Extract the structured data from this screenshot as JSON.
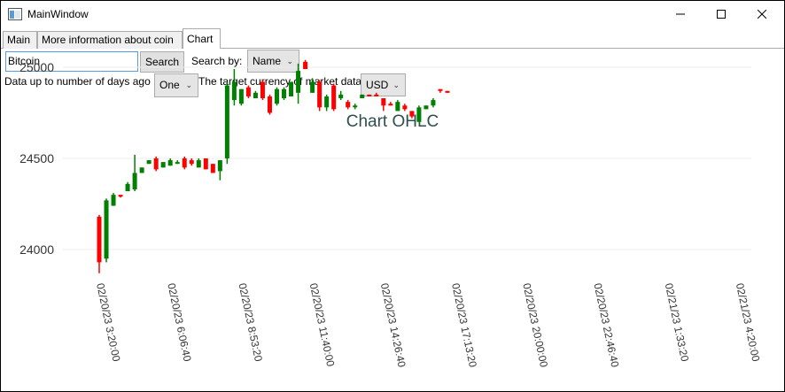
{
  "window": {
    "title": "MainWindow",
    "minimize_icon": "minimize-icon",
    "maximize_icon": "maximize-icon",
    "close_icon": "close-icon"
  },
  "tabs": [
    {
      "label": "Main",
      "active": false
    },
    {
      "label": "More information about coin",
      "active": false
    },
    {
      "label": "Chart",
      "active": true
    }
  ],
  "search": {
    "value": "Bitcoin",
    "button_label": "Search",
    "search_by_label": "Search by:",
    "search_by_value": "Name"
  },
  "filters": {
    "days_label": "Data up to number of days ago",
    "days_value": "One",
    "currency_label": "The target currency of market data",
    "currency_value": "USD"
  },
  "colors": {
    "up": "#008000",
    "down": "#ff0000",
    "title": "#2f4f4f"
  },
  "chart_data": {
    "type": "ohlc-candlestick",
    "title": "Chart OHLC",
    "y_ticks": [
      24000,
      24500,
      25000
    ],
    "ylim": [
      23800,
      25100
    ],
    "x_ticks": [
      "02/20/23 3:20:00",
      "02/20/23 6:06:40",
      "02/20/23 8:53:20",
      "02/20/23 11:40:00",
      "02/20/23 14:26:40",
      "02/20/23 17:13:20",
      "02/20/23 20:00:00",
      "02/20/23 22:46:40",
      "02/21/23 1:33:20",
      "02/21/23 4:20:00"
    ],
    "candles": [
      {
        "t": 0.0,
        "o": 24180,
        "h": 24190,
        "l": 23870,
        "c": 23930
      },
      {
        "t": 0.5,
        "o": 23950,
        "h": 24280,
        "l": 23930,
        "c": 24270
      },
      {
        "t": 1.0,
        "o": 24240,
        "h": 24310,
        "l": 24240,
        "c": 24300
      },
      {
        "t": 1.5,
        "o": 24300,
        "h": 24300,
        "l": 24285,
        "c": 24295
      },
      {
        "t": 2.0,
        "o": 24320,
        "h": 24370,
        "l": 24320,
        "c": 24360
      },
      {
        "t": 2.5,
        "o": 24330,
        "h": 24520,
        "l": 24320,
        "c": 24420
      },
      {
        "t": 3.0,
        "o": 24420,
        "h": 24450,
        "l": 24420,
        "c": 24450
      },
      {
        "t": 3.5,
        "o": 24470,
        "h": 24490,
        "l": 24470,
        "c": 24490
      },
      {
        "t": 4.0,
        "o": 24500,
        "h": 24510,
        "l": 24430,
        "c": 24440
      },
      {
        "t": 4.5,
        "o": 24450,
        "h": 24480,
        "l": 24450,
        "c": 24480
      },
      {
        "t": 5.0,
        "o": 24460,
        "h": 24500,
        "l": 24460,
        "c": 24490
      },
      {
        "t": 5.5,
        "o": 24470,
        "h": 24490,
        "l": 24470,
        "c": 24480
      },
      {
        "t": 6.0,
        "o": 24500,
        "h": 24510,
        "l": 24440,
        "c": 24450
      },
      {
        "t": 6.5,
        "o": 24490,
        "h": 24500,
        "l": 24460,
        "c": 24470
      },
      {
        "t": 7.0,
        "o": 24450,
        "h": 24500,
        "l": 24450,
        "c": 24490
      },
      {
        "t": 7.5,
        "o": 24500,
        "h": 24500,
        "l": 24440,
        "c": 24440
      },
      {
        "t": 8.0,
        "o": 24470,
        "h": 24470,
        "l": 24420,
        "c": 24420
      },
      {
        "t": 8.5,
        "o": 24430,
        "h": 24490,
        "l": 24380,
        "c": 24490
      },
      {
        "t": 9.0,
        "o": 24500,
        "h": 24920,
        "l": 24470,
        "c": 24900
      },
      {
        "t": 9.5,
        "o": 24820,
        "h": 24990,
        "l": 24790,
        "c": 24920
      },
      {
        "t": 10.0,
        "o": 24800,
        "h": 24880,
        "l": 24790,
        "c": 24880
      },
      {
        "t": 10.5,
        "o": 24890,
        "h": 24900,
        "l": 24830,
        "c": 24840
      },
      {
        "t": 11.0,
        "o": 24830,
        "h": 24870,
        "l": 24830,
        "c": 24860
      },
      {
        "t": 11.5,
        "o": 24920,
        "h": 24930,
        "l": 24820,
        "c": 24830
      },
      {
        "t": 12.0,
        "o": 24840,
        "h": 24850,
        "l": 24740,
        "c": 24750
      },
      {
        "t": 12.5,
        "o": 24800,
        "h": 24890,
        "l": 24790,
        "c": 24880
      },
      {
        "t": 13.0,
        "o": 24830,
        "h": 24890,
        "l": 24820,
        "c": 24880
      },
      {
        "t": 13.5,
        "o": 24840,
        "h": 24920,
        "l": 24840,
        "c": 24920
      },
      {
        "t": 14.0,
        "o": 24860,
        "h": 25020,
        "l": 24800,
        "c": 24980
      },
      {
        "t": 14.5,
        "o": 25030,
        "h": 25040,
        "l": 24990,
        "c": 24990
      },
      {
        "t": 15.0,
        "o": 24860,
        "h": 24940,
        "l": 24860,
        "c": 24920
      },
      {
        "t": 15.5,
        "o": 24920,
        "h": 24930,
        "l": 24760,
        "c": 24780
      },
      {
        "t": 16.0,
        "o": 24780,
        "h": 24850,
        "l": 24760,
        "c": 24840
      },
      {
        "t": 16.5,
        "o": 24900,
        "h": 24910,
        "l": 24760,
        "c": 24770
      },
      {
        "t": 17.0,
        "o": 24830,
        "h": 24870,
        "l": 24820,
        "c": 24850
      },
      {
        "t": 17.5,
        "o": 24810,
        "h": 24820,
        "l": 24770,
        "c": 24780
      },
      {
        "t": 18.0,
        "o": 24790,
        "h": 24800,
        "l": 24770,
        "c": 24790
      },
      {
        "t": 18.5,
        "o": 24830,
        "h": 24850,
        "l": 24830,
        "c": 24850
      },
      {
        "t": 19.0,
        "o": 24850,
        "h": 24850,
        "l": 24840,
        "c": 24840
      },
      {
        "t": 19.5,
        "o": 24850,
        "h": 24860,
        "l": 24840,
        "c": 24840
      },
      {
        "t": 20.0,
        "o": 24830,
        "h": 24830,
        "l": 24760,
        "c": 24790
      },
      {
        "t": 20.5,
        "o": 24800,
        "h": 24810,
        "l": 24790,
        "c": 24790
      },
      {
        "t": 21.0,
        "o": 24760,
        "h": 24820,
        "l": 24760,
        "c": 24810
      },
      {
        "t": 21.5,
        "o": 24790,
        "h": 24800,
        "l": 24760,
        "c": 24770
      },
      {
        "t": 22.0,
        "o": 24760,
        "h": 24760,
        "l": 24720,
        "c": 24730
      },
      {
        "t": 22.5,
        "o": 24700,
        "h": 24790,
        "l": 24700,
        "c": 24780
      },
      {
        "t": 23.0,
        "o": 24770,
        "h": 24790,
        "l": 24770,
        "c": 24790
      },
      {
        "t": 23.5,
        "o": 24790,
        "h": 24830,
        "l": 24780,
        "c": 24820
      },
      {
        "t": 24.0,
        "o": 24880,
        "h": 24880,
        "l": 24860,
        "c": 24870
      },
      {
        "t": 24.5,
        "o": 24870,
        "h": 24870,
        "l": 24860,
        "c": 24860
      }
    ]
  }
}
